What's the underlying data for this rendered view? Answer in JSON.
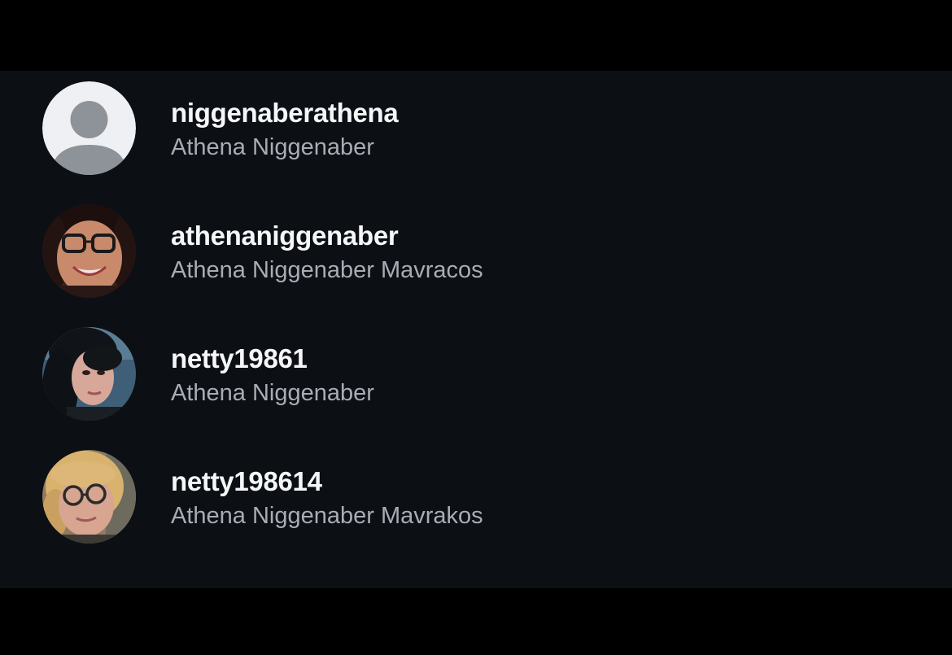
{
  "accounts": [
    {
      "username": "niggenaberathena",
      "full_name": "Athena Niggenaber",
      "avatar": "default-profile-icon"
    },
    {
      "username": "athenaniggenaber",
      "full_name": "Athena Niggenaber Mavracos",
      "avatar": "profile-photo"
    },
    {
      "username": "netty19861",
      "full_name": "Athena Niggenaber",
      "avatar": "profile-photo"
    },
    {
      "username": "netty198614",
      "full_name": "Athena Niggenaber Mavrakos",
      "avatar": "profile-photo"
    }
  ],
  "colors": {
    "background": "#000000",
    "panel": "#0c0f14",
    "username": "#f5f6f8",
    "full_name": "#a8adb5"
  }
}
